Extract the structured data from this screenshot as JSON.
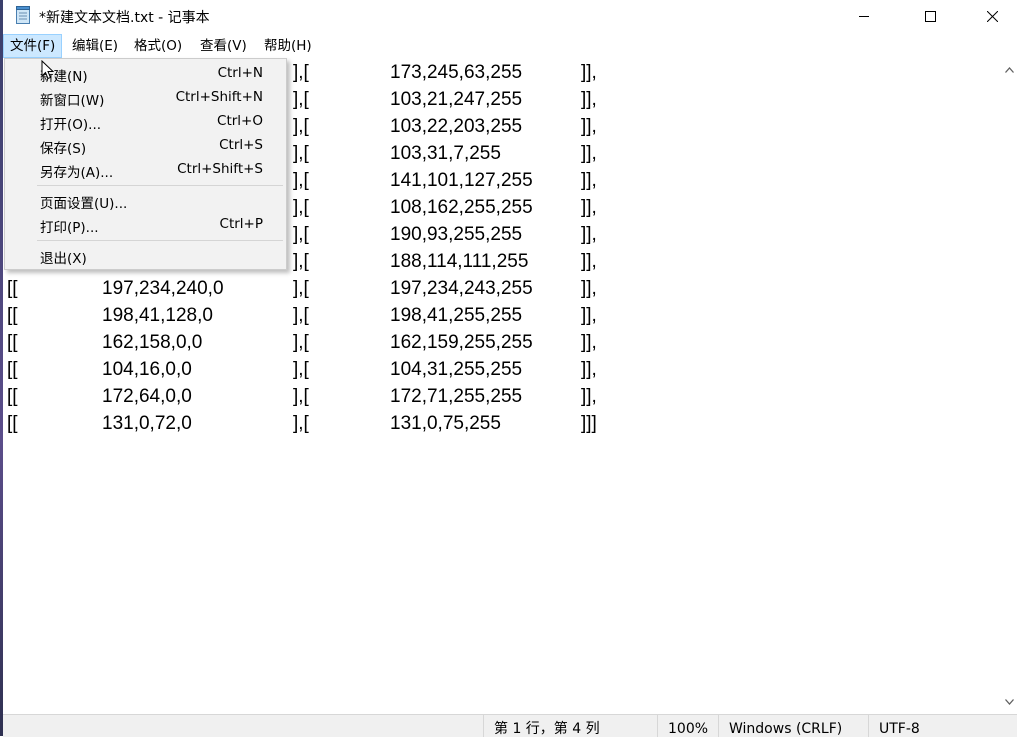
{
  "window": {
    "title": "*新建文本文档.txt - 记事本",
    "app_icon": "notepad-icon",
    "minimize_icon": "minimize-icon",
    "maximize_icon": "maximize-icon",
    "close_icon": "close-icon"
  },
  "menubar": {
    "items": [
      "文件(F)",
      "编辑(E)",
      "格式(O)",
      "查看(V)",
      "帮助(H)"
    ],
    "active": "文件(F)"
  },
  "file_menu": {
    "items": [
      {
        "label": "新建(N)",
        "accel": "Ctrl+N"
      },
      {
        "label": "新窗口(W)",
        "accel": "Ctrl+Shift+N"
      },
      {
        "label": "打开(O)...",
        "accel": "Ctrl+O"
      },
      {
        "label": "保存(S)",
        "accel": "Ctrl+S"
      },
      {
        "label": "另存为(A)...",
        "accel": "Ctrl+Shift+S"
      },
      {
        "label": "页面设置(U)...",
        "accel": ""
      },
      {
        "label": "打印(P)...",
        "accel": "Ctrl+P"
      },
      {
        "label": "退出(X)",
        "accel": ""
      }
    ]
  },
  "editor": {
    "lines": [
      [
        "",
        "",
        "],[",
        "173,245,63,255",
        "]],"
      ],
      [
        "",
        "",
        "],[",
        "103,21,247,255",
        "]],"
      ],
      [
        "",
        "",
        "],[",
        "103,22,203,255",
        "]],"
      ],
      [
        "",
        "",
        "],[",
        "103,31,7,255",
        "]],"
      ],
      [
        "",
        "",
        "],[",
        "141,101,127,255",
        "]],"
      ],
      [
        "",
        "",
        "],[",
        "108,162,255,255",
        "]],"
      ],
      [
        "",
        "",
        "],[",
        "190,93,255,255",
        "]],"
      ],
      [
        "",
        "",
        "],[",
        "188,114,111,255",
        "]],"
      ],
      [
        "[[",
        "197,234,240,0",
        "],[",
        "197,234,243,255",
        "]],"
      ],
      [
        "[[",
        "198,41,128,0",
        "],[",
        "198,41,255,255",
        "]],"
      ],
      [
        "[[",
        "162,158,0,0",
        "],[",
        "162,159,255,255",
        "]],"
      ],
      [
        "[[",
        "104,16,0,0",
        "],[",
        "104,31,255,255",
        "]],"
      ],
      [
        "[[",
        "172,64,0,0",
        "],[",
        "172,71,255,255",
        "]],"
      ],
      [
        "[[",
        "131,0,72,0",
        "],[",
        "131,0,75,255",
        "]]]"
      ]
    ]
  },
  "scrollbar": {
    "up_icon": "scroll-up-arrow-icon",
    "down_icon": "scroll-down-arrow-icon"
  },
  "statusbar": {
    "position": "第 1 行，第 4 列",
    "zoom": "100%",
    "line_ending": "Windows (CRLF)",
    "encoding": "UTF-8"
  },
  "colors": {
    "menu_active_bg": "#cce8ff",
    "menu_active_border": "#99d1ff",
    "dropdown_bg": "#f2f2f2",
    "statusbar_bg": "#f0f0f0"
  }
}
